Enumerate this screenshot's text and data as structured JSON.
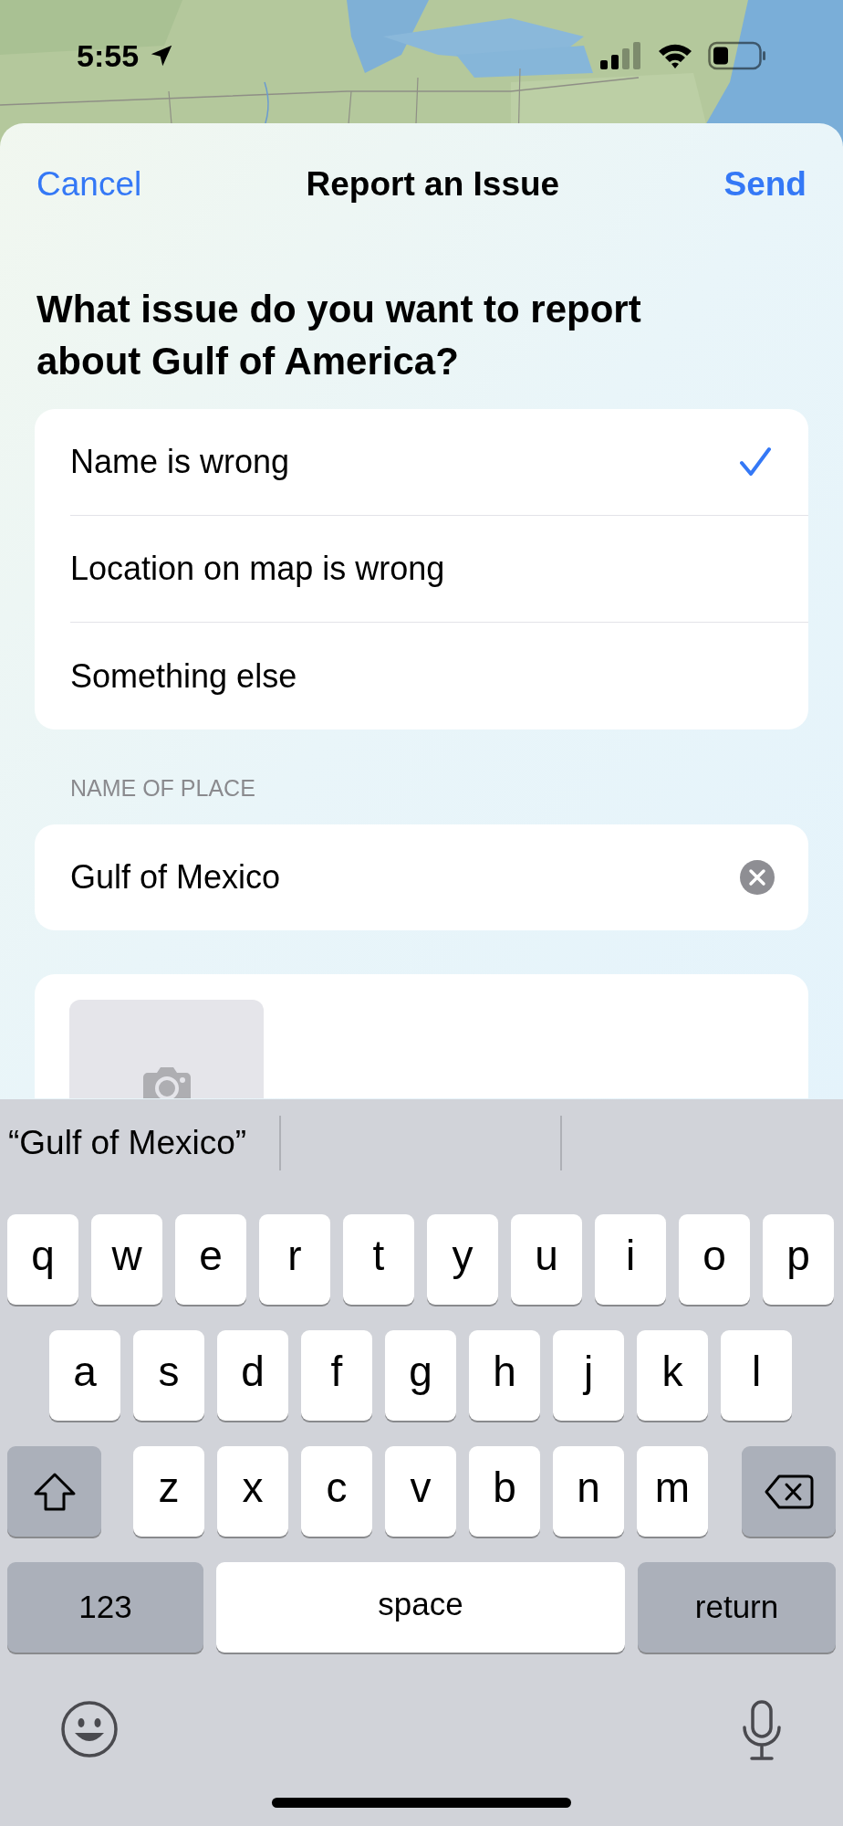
{
  "status_bar": {
    "time": "5:55"
  },
  "nav": {
    "cancel": "Cancel",
    "title": "Report an Issue",
    "send": "Send"
  },
  "question": "What issue do you want to report about Gulf of America?",
  "options": [
    {
      "label": "Name is wrong",
      "selected": true
    },
    {
      "label": "Location on map is wrong",
      "selected": false
    },
    {
      "label": "Something else",
      "selected": false
    }
  ],
  "section_label": "NAME OF PLACE",
  "name_field": {
    "value": "Gulf of Mexico"
  },
  "keyboard": {
    "suggestions": [
      "“Gulf of Mexico”"
    ],
    "key_rows": [
      {
        "keys": [
          {
            "kind": "letter",
            "label": "q"
          },
          {
            "kind": "letter",
            "label": "w"
          },
          {
            "kind": "letter",
            "label": "e"
          },
          {
            "kind": "letter",
            "label": "r"
          },
          {
            "kind": "letter",
            "label": "t"
          },
          {
            "kind": "letter",
            "label": "y"
          },
          {
            "kind": "letter",
            "label": "u"
          },
          {
            "kind": "letter",
            "label": "i"
          },
          {
            "kind": "letter",
            "label": "o"
          },
          {
            "kind": "letter",
            "label": "p"
          }
        ]
      },
      {
        "keys": [
          {
            "kind": "letter",
            "label": "a"
          },
          {
            "kind": "letter",
            "label": "s"
          },
          {
            "kind": "letter",
            "label": "d"
          },
          {
            "kind": "letter",
            "label": "f"
          },
          {
            "kind": "letter",
            "label": "g"
          },
          {
            "kind": "letter",
            "label": "h"
          },
          {
            "kind": "letter",
            "label": "j"
          },
          {
            "kind": "letter",
            "label": "k"
          },
          {
            "kind": "letter",
            "label": "l"
          }
        ]
      },
      {
        "keys": [
          {
            "kind": "shift"
          },
          {
            "kind": "letter",
            "label": "z"
          },
          {
            "kind": "letter",
            "label": "x"
          },
          {
            "kind": "letter",
            "label": "c"
          },
          {
            "kind": "letter",
            "label": "v"
          },
          {
            "kind": "letter",
            "label": "b"
          },
          {
            "kind": "letter",
            "label": "n"
          },
          {
            "kind": "letter",
            "label": "m"
          },
          {
            "kind": "delete"
          }
        ]
      },
      {
        "keys": [
          {
            "kind": "numbers",
            "label": "123"
          },
          {
            "kind": "space",
            "label": "space"
          },
          {
            "kind": "return",
            "label": "return"
          }
        ]
      }
    ]
  }
}
